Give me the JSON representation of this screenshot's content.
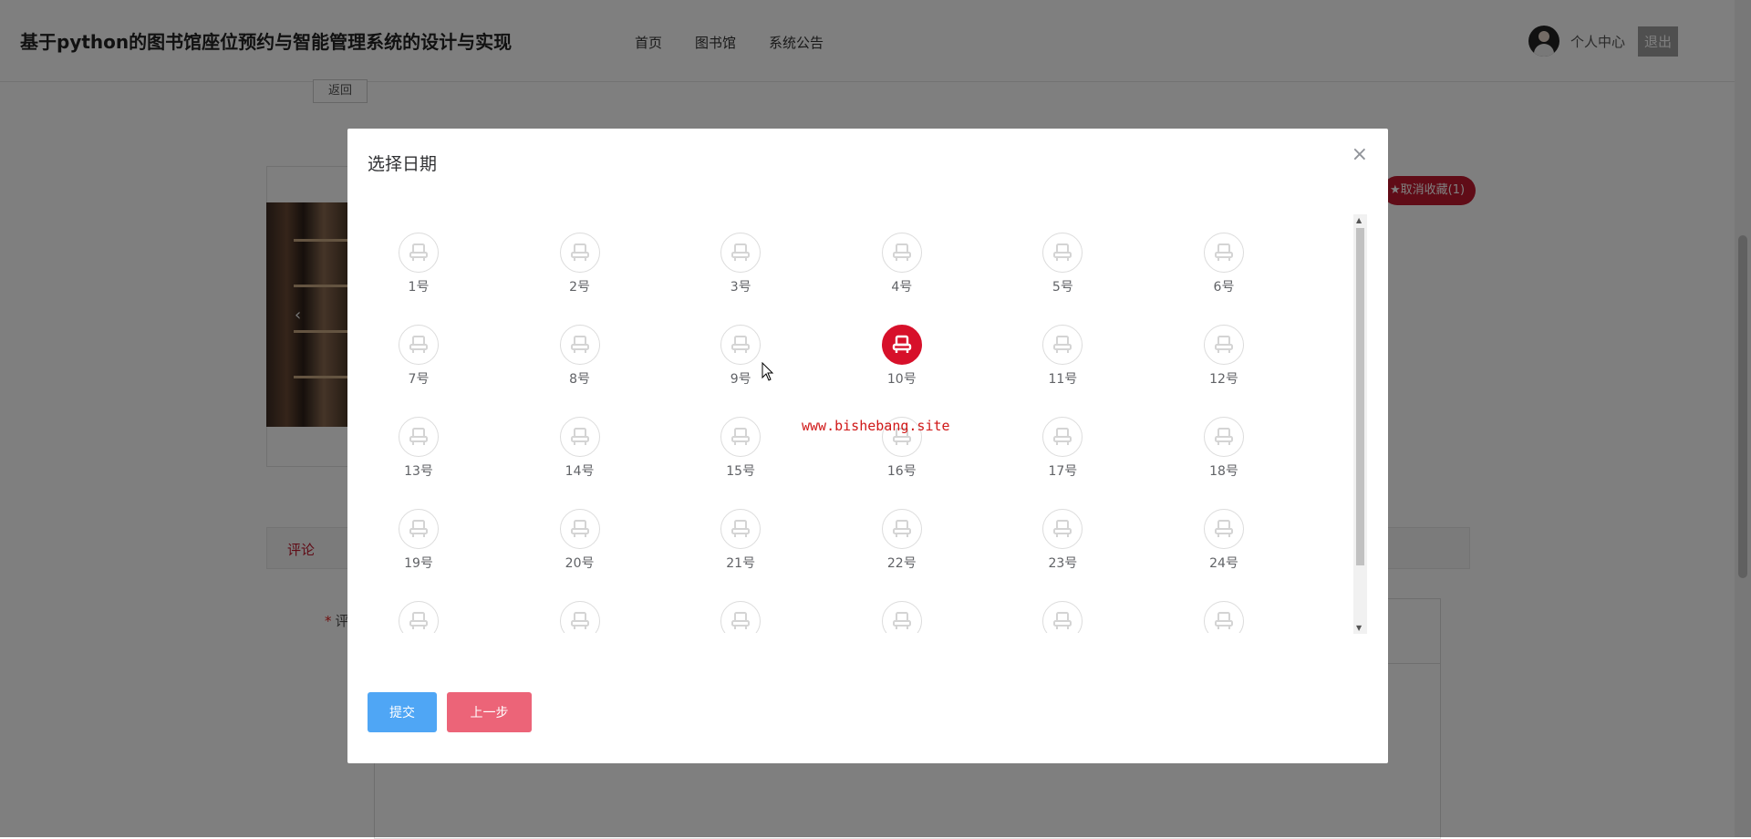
{
  "header": {
    "site_title": "基于python的图书馆座位预约与智能管理系统的设计与实现",
    "nav": [
      "首页",
      "图书馆",
      "系统公告"
    ],
    "profile_label": "个人中心",
    "logout_label": "退出"
  },
  "page": {
    "back_label": "返回",
    "favorite_label": "★取消收藏(1)",
    "carousel_prev": "‹",
    "tab_comment": "评论",
    "comment_label": "评",
    "required_mark": "*"
  },
  "dialog": {
    "title": "选择日期",
    "close_icon": "×",
    "submit_label": "提交",
    "prev_label": "上一步",
    "watermark": "www.bishebang.site",
    "selected_seat": "10号",
    "seats": [
      "1号",
      "2号",
      "3号",
      "4号",
      "5号",
      "6号",
      "7号",
      "8号",
      "9号",
      "10号",
      "11号",
      "12号",
      "13号",
      "14号",
      "15号",
      "16号",
      "17号",
      "18号",
      "19号",
      "20号",
      "21号",
      "22号",
      "23号",
      "24号"
    ],
    "partial_row_count": 6
  },
  "colors": {
    "selected_seat": "#d7102a",
    "submit_button": "#4fa6f5",
    "prev_button": "#ec6478",
    "favorite_badge": "#c0182e",
    "logout_button": "#9e9e9e"
  }
}
